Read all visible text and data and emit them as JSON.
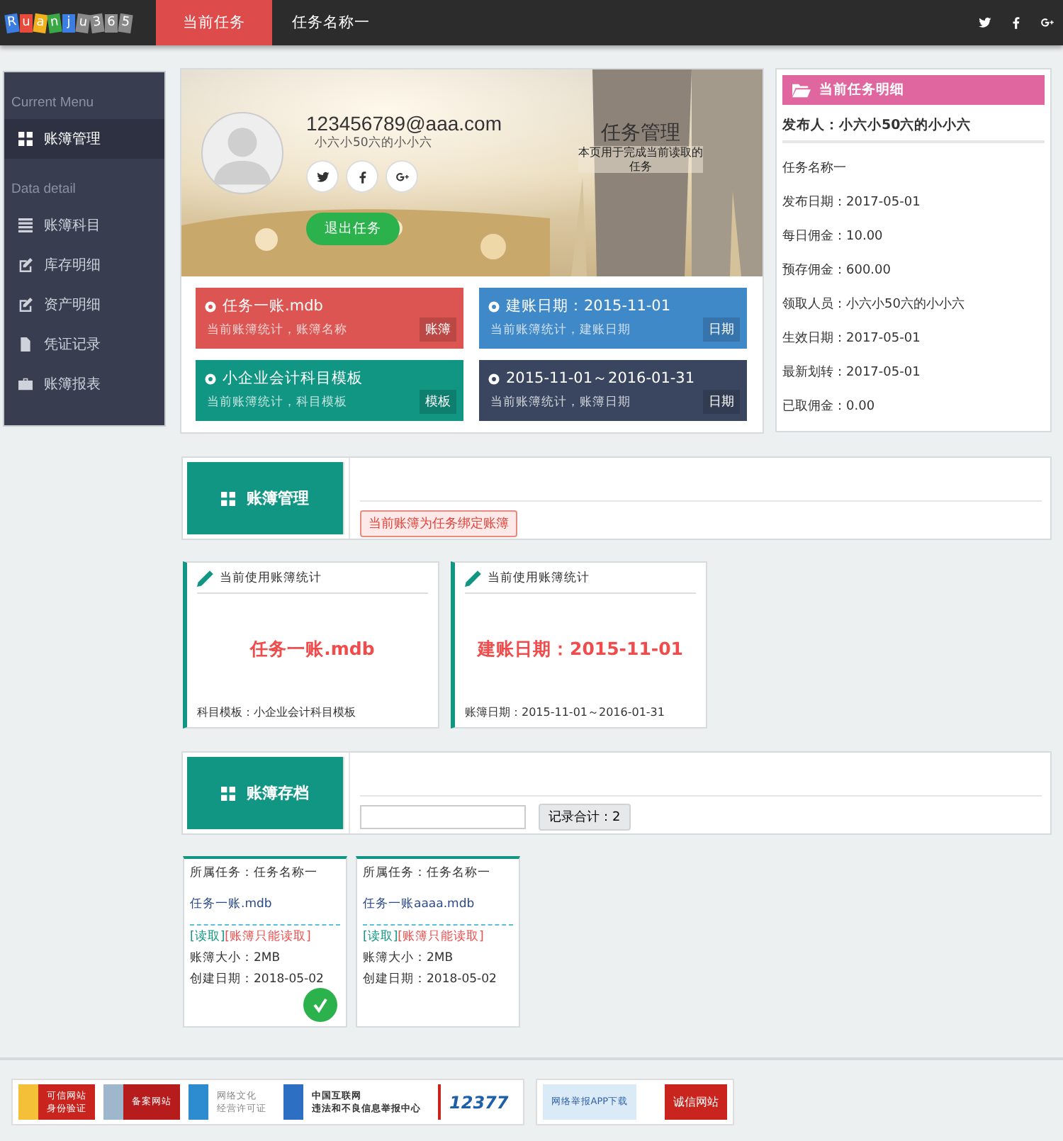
{
  "topbar": {
    "logo_letters": [
      "R",
      "u",
      "a",
      "n",
      "j",
      "u",
      "3",
      "6",
      "5"
    ],
    "tabs": [
      {
        "label": "当前任务",
        "selected": true
      },
      {
        "label": "任务名称一",
        "selected": false
      }
    ]
  },
  "sidebar": {
    "sections": [
      {
        "heading": "Current Menu",
        "items": [
          {
            "label": "账簿管理",
            "selected": true
          }
        ]
      },
      {
        "heading": "Data detail",
        "items": [
          {
            "label": "账簿科目",
            "selected": false
          },
          {
            "label": "库存明细",
            "selected": false
          },
          {
            "label": "资产明细",
            "selected": false
          },
          {
            "label": "凭证记录",
            "selected": false
          },
          {
            "label": "账簿报表",
            "selected": false
          }
        ]
      }
    ]
  },
  "profile": {
    "email": "123456789@aaa.com",
    "name": "小六小50六的小小六",
    "exit_button": "退出任务",
    "title": "任务管理",
    "subtitle": "本页用于完成当前读取的任务"
  },
  "tiles": [
    {
      "title": "任务一账.mdb",
      "sub": "当前账簿统计，账簿名称",
      "tag": "账簿",
      "color": "#dc5552"
    },
    {
      "title": "建账日期：2015-11-01",
      "sub": "当前账簿统计，建账日期",
      "tag": "日期",
      "color": "#4089c9"
    },
    {
      "title": "小企业会计科目模板",
      "sub": "当前账簿统计，科目模板",
      "tag": "模板",
      "color": "#119683"
    },
    {
      "title": "2015-11-01～2016-01-31",
      "sub": "当前账簿统计，账簿日期",
      "tag": "日期",
      "color": "#3a4660"
    }
  ],
  "task_detail": {
    "header": "当前任务明细",
    "publisher": "发布人：小六小50六的小小六",
    "rows": [
      "任务名称一",
      "发布日期：2017-05-01",
      "每日佣金：10.00",
      "预存佣金：600.00",
      "领取人员：小六小50六的小小六",
      "生效日期：2017-05-01",
      "最新划转：2017-05-01",
      "已取佣金：0.00"
    ]
  },
  "ledger_manage": {
    "title": "账簿管理",
    "notice": "当前账簿为任务绑定账簿",
    "cards": [
      {
        "header": "当前使用账簿统计",
        "value": "任务一账.mdb",
        "footer": "科目模板：小企业会计科目模板"
      },
      {
        "header": "当前使用账簿统计",
        "value": "建账日期：2015-11-01",
        "footer": "账簿日期：2015-11-01～2016-01-31"
      }
    ]
  },
  "ledger_archive": {
    "title": "账簿存档",
    "count_button": "记录合计：2",
    "files": [
      {
        "task": "所属任务：任务名称一",
        "file": "任务一账.mdb",
        "read_link": "[读取]",
        "readonly": "[账簿只能读取]",
        "size": "账簿大小：2MB",
        "created": "创建日期：2018-05-02",
        "selected": true
      },
      {
        "task": "所属任务：任务名称一",
        "file": "任务一账aaaa.mdb",
        "read_link": "[读取]",
        "readonly": "[账簿只能读取]",
        "size": "账簿大小：2MB",
        "created": "创建日期：2018-05-02",
        "selected": false
      }
    ]
  },
  "footer_badges": [
    [
      "可信网站",
      "身份验证"
    ],
    [
      "备案网站"
    ],
    [
      "网络文化",
      "经营许可证"
    ],
    [
      "中国互联网",
      "违法和不良信息举报中心"
    ],
    [
      "12377"
    ]
  ],
  "footer_badges_2": [
    [
      "网络举报APP下载"
    ],
    [
      "诚信网站"
    ]
  ]
}
